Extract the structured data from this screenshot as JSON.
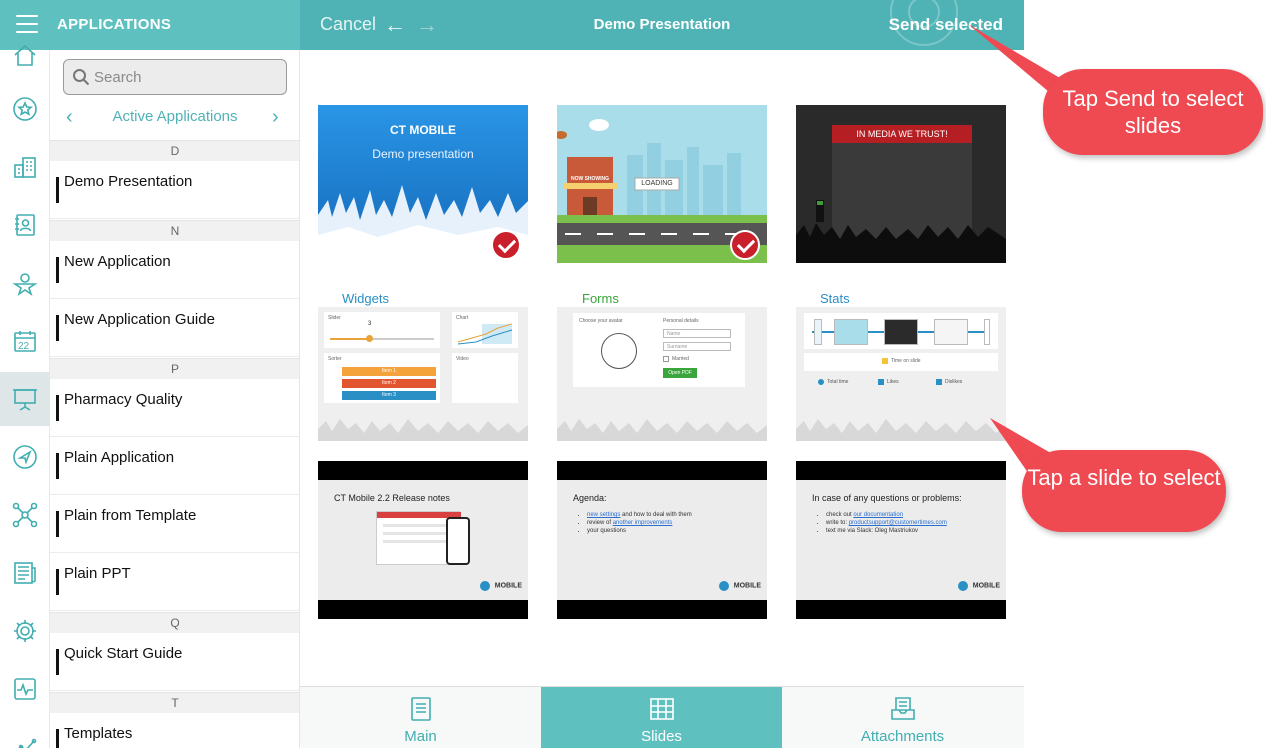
{
  "header": {
    "menu_icon": "hamburger-icon",
    "section_title": "APPLICATIONS",
    "cancel_label": "Cancel",
    "back_icon": "arrow-left-icon",
    "forward_icon": "arrow-right-icon",
    "presentation_title": "Demo Presentation",
    "send_label": "Send selected"
  },
  "rail": {
    "items": [
      "home-icon",
      "star-icon",
      "buildings-icon",
      "contacts-icon",
      "person-icon",
      "calendar-icon",
      "presentation-icon",
      "navigation-icon",
      "network-icon",
      "news-icon",
      "settings-icon",
      "activity-icon",
      "chart-icon"
    ],
    "calendar_day": "22",
    "active": "presentation-icon"
  },
  "sidebar": {
    "search_placeholder": "Search",
    "filter_label": "Active Applications",
    "sections": [
      {
        "letter": "D",
        "items": [
          "Demo Presentation"
        ]
      },
      {
        "letter": "N",
        "items": [
          "New Application",
          "New Application Guide"
        ]
      },
      {
        "letter": "P",
        "items": [
          "Pharmacy Quality",
          "Plain Application",
          "Plain from Template",
          "Plain PPT"
        ]
      },
      {
        "letter": "Q",
        "items": [
          "Quick Start Guide"
        ]
      },
      {
        "letter": "T",
        "items": [
          "Templates"
        ]
      }
    ]
  },
  "slides": {
    "s1": {
      "brand": "CT MOBILE",
      "subtitle": "Demo presentation",
      "selected": true
    },
    "s2": {
      "sign": "NOW SHOWING",
      "loading": "LOADING",
      "selected": true
    },
    "s3": {
      "banner": "IN MEDIA WE TRUST!",
      "selected": false
    },
    "s4": {
      "label": "Widgets",
      "slider": "Slider",
      "slider_value": "3",
      "chart": "Chart",
      "sorter": "Sorter",
      "video": "Video",
      "items": [
        "Item 1",
        "Item 2",
        "Item 3"
      ]
    },
    "s5": {
      "label": "Forms",
      "avatar": "Choose your avatar",
      "details": "Personal details",
      "name": "Name",
      "surname": "Surname",
      "married": "Married",
      "button": "Open PDF"
    },
    "s6": {
      "label": "Stats",
      "time_on_slide": "Time on slide",
      "stats": [
        "Total time",
        "Likes",
        "Dislikes"
      ]
    },
    "s7": {
      "title": "CT Mobile 2.2 Release notes",
      "logo": "MOBILE"
    },
    "s8": {
      "heading": "Agenda:",
      "b1_link": "new settings",
      "b1_rest": " and how to deal with them",
      "b2_pre": "review of ",
      "b2_link": "another improvements",
      "b3": "your questions",
      "logo": "MOBILE"
    },
    "s9": {
      "heading": "In case of any questions or problems:",
      "b1_pre": "check out ",
      "b1_link": "our documentation",
      "b2_pre": "write to: ",
      "b2_link": "productsupport@customertimes.com",
      "b3": "text me via Slack: Oleg Mastriukov",
      "logo": "MOBILE"
    }
  },
  "callouts": {
    "send": "Tap Send to select slides",
    "tap": "Tap a slide to select"
  },
  "tabs": {
    "main": "Main",
    "slides": "Slides",
    "attachments": "Attachments",
    "active": "Slides"
  },
  "colors": {
    "accent": "#4fb3b6",
    "callout": "#ef4a52",
    "check": "#c9202b"
  }
}
